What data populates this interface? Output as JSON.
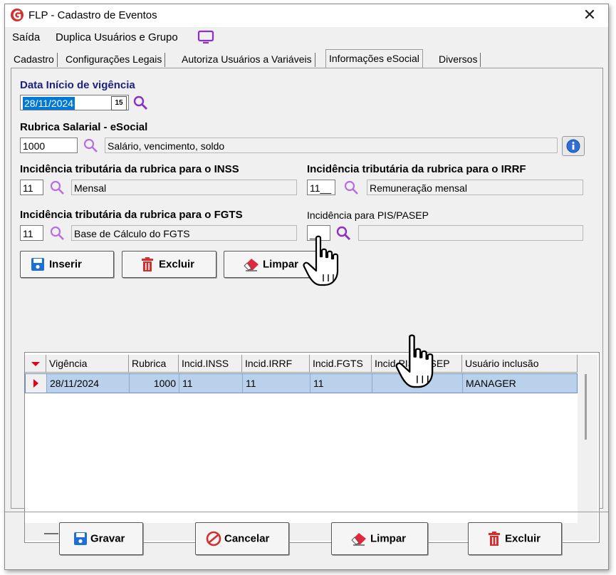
{
  "window": {
    "title": "FLP - Cadastro de Eventos",
    "close_glyph": "✕"
  },
  "menu": {
    "items": [
      "Saída",
      "Duplica Usuários e Grupo"
    ]
  },
  "tabs": [
    "Cadastro",
    "Configurações Legais",
    "Autoriza Usuários a Variáveis",
    "Informações eSocial",
    "Diversos"
  ],
  "form": {
    "data_inicio": {
      "label": "Data Início de vigência",
      "value": "28/11/2024",
      "calendar_glyph": "15"
    },
    "rubrica": {
      "label": "Rubrica Salarial - eSocial",
      "code": "1000",
      "description": "Salário, vencimento, soldo"
    },
    "inss": {
      "label": "Incidência tributária da rubrica para o INSS",
      "code": "11",
      "description": "Mensal"
    },
    "irrf": {
      "label": "Incidência tributária da rubrica para o IRRF",
      "code": "11__",
      "description": "Remuneração mensal"
    },
    "fgts": {
      "label": "Incidência tributária da rubrica para o FGTS",
      "code": "11",
      "description": "Base de Cálculo do FGTS"
    },
    "pis": {
      "label": "Incidência para PIS/PASEP",
      "code": "__",
      "description": ""
    }
  },
  "actions": {
    "inserir": "Inserir",
    "excluir": "Excluir",
    "limpar": "Limpar"
  },
  "grid": {
    "columns": [
      "Vigência",
      "Rubrica",
      "Incid.INSS",
      "Incid.IRRF",
      "Incid.FGTS",
      "Incid.PIS/PASEP",
      "Usuário inclusão"
    ],
    "rows": [
      {
        "vigencia": "28/11/2024",
        "rubrica": "1000",
        "inss": "11",
        "irrf": "11",
        "fgts": "11",
        "pis": "",
        "usuario": "MANAGER"
      }
    ]
  },
  "footer": {
    "gravar": "Gravar",
    "cancelar": "Cancelar",
    "limpar": "Limpar",
    "excluir": "Excluir"
  },
  "colors": {
    "accent_purple": "#8b2fc9",
    "label_navy": "#1a237e",
    "selection_blue": "#0078d7",
    "row_highlight": "#b9d1ea",
    "delete_red": "#d32f2f",
    "save_blue": "#1e6fd1"
  }
}
